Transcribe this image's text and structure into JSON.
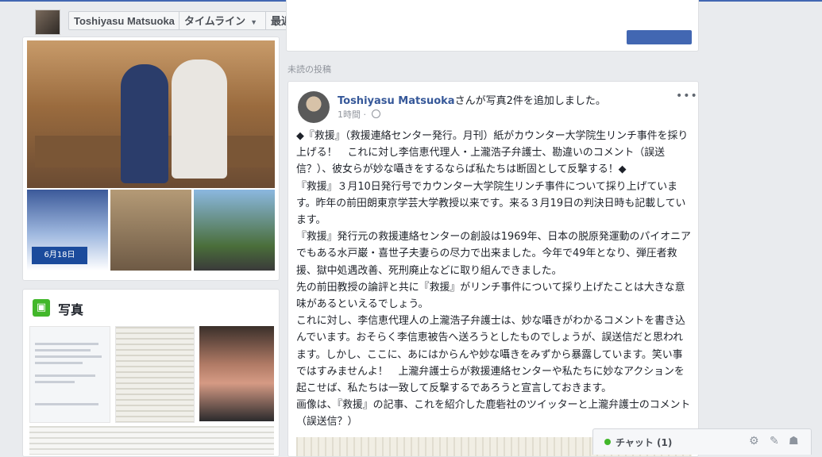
{
  "header": {
    "profile_name": "Toshiyasu Matsuoka",
    "timeline_label": "タイムライン",
    "recent_label": "最近"
  },
  "sidebar": {
    "photos_title": "写真",
    "thumb_badge": "6月18日"
  },
  "feed": {
    "section_label": "未読の投稿"
  },
  "post": {
    "author": "Toshiyasu Matsuoka",
    "action": "さんが写真2件を追加しました。",
    "time": "1時間",
    "paragraphs": [
      "◆『救援』（救援連絡センター発行。月刊）紙がカウンター大学院生リンチ事件を採り上げる！　これに対し李信恵代理人・上瀧浩子弁護士、勘違いのコメント（誤送信？）、彼女らが妙な囁きをするならば私たちは断固として反撃する！◆",
      "『救援』３月10日発行号でカウンター大学院生リンチ事件について採り上げています。昨年の前田朗東京学芸大学教授以来です。来る３月19日の判決日時も記載しています。",
      "『救援』発行元の救援連絡センターの創設は1969年、日本の脱原発運動のパイオニアでもある水戸巌・喜世子夫妻らの尽力で出来ました。今年で49年となり、弾圧者救援、獄中処遇改善、死刑廃止などに取り組んできました。",
      "先の前田教授の論評と共に『救援』がリンチ事件について採り上げたことは大きな意味があるといえるでしょう。",
      "これに対し、李信恵代理人の上瀧浩子弁護士は、妙な囁きがわかるコメントを書き込んでいます。おそらく李信恵被告へ送ろうとしたものでしょうが、誤送信だと思われます。しかし、ここに、あにはからんや妙な囁きをみずから暴露しています。笑い事ではすみませんよ！　上瀧弁護士らが救援連絡センターや私たちに妙なアクションを起こせば、私たちは一致して反撃するであろうと宣言しておきます。",
      "画像は、『救援』の記事、これを紹介した鹿砦社のツイッターと上瀧弁護士のコメント（誤送信？）"
    ]
  },
  "chat": {
    "label": "チャット (1)"
  },
  "icons": [
    "caret-down-icon",
    "photo-icon",
    "globe-icon",
    "more-icon",
    "gear-icon",
    "compose-icon",
    "group-icon"
  ]
}
